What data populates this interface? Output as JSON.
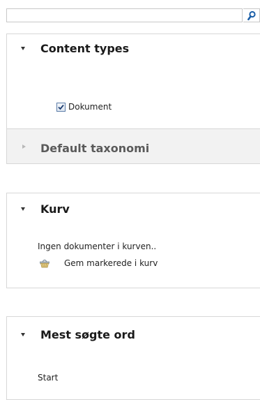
{
  "search": {
    "value": "",
    "placeholder": "",
    "button_icon": "search-icon",
    "accent": "#1b5fa8"
  },
  "panels": {
    "content_types": {
      "title": "Content types",
      "expanded": true,
      "items": [
        {
          "label": "Dokument",
          "checked": true
        }
      ]
    },
    "default_taxonomi": {
      "title": "Default taxonomi",
      "expanded": false
    },
    "kurv": {
      "title": "Kurv",
      "expanded": true,
      "empty_text": "Ingen dokumenter i kurven..",
      "action_label": "Gem markerede i kurv",
      "action_icon": "basket-icon"
    },
    "mest_sogte_ord": {
      "title": "Mest søgte ord",
      "expanded": true,
      "items": [
        "Start"
      ]
    }
  },
  "colors": {
    "border": "#d7d7d7",
    "collapsed_bg": "#f2f2f2",
    "checkbox_border": "#5b7ca8"
  }
}
